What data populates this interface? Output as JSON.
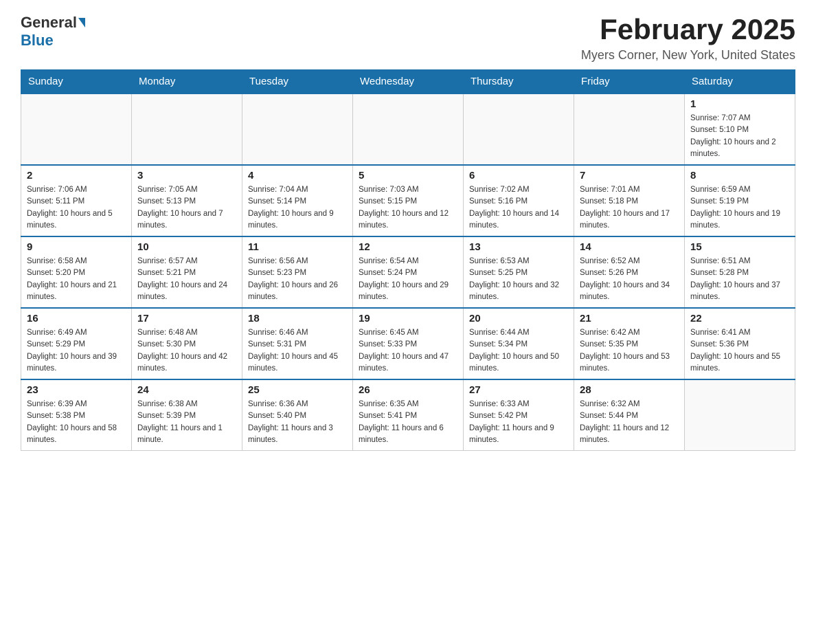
{
  "logo": {
    "general": "General",
    "blue": "Blue"
  },
  "header": {
    "month_title": "February 2025",
    "location": "Myers Corner, New York, United States"
  },
  "days_of_week": [
    "Sunday",
    "Monday",
    "Tuesday",
    "Wednesday",
    "Thursday",
    "Friday",
    "Saturday"
  ],
  "weeks": [
    [
      {
        "day": "",
        "sunrise": "",
        "sunset": "",
        "daylight": ""
      },
      {
        "day": "",
        "sunrise": "",
        "sunset": "",
        "daylight": ""
      },
      {
        "day": "",
        "sunrise": "",
        "sunset": "",
        "daylight": ""
      },
      {
        "day": "",
        "sunrise": "",
        "sunset": "",
        "daylight": ""
      },
      {
        "day": "",
        "sunrise": "",
        "sunset": "",
        "daylight": ""
      },
      {
        "day": "",
        "sunrise": "",
        "sunset": "",
        "daylight": ""
      },
      {
        "day": "1",
        "sunrise": "Sunrise: 7:07 AM",
        "sunset": "Sunset: 5:10 PM",
        "daylight": "Daylight: 10 hours and 2 minutes."
      }
    ],
    [
      {
        "day": "2",
        "sunrise": "Sunrise: 7:06 AM",
        "sunset": "Sunset: 5:11 PM",
        "daylight": "Daylight: 10 hours and 5 minutes."
      },
      {
        "day": "3",
        "sunrise": "Sunrise: 7:05 AM",
        "sunset": "Sunset: 5:13 PM",
        "daylight": "Daylight: 10 hours and 7 minutes."
      },
      {
        "day": "4",
        "sunrise": "Sunrise: 7:04 AM",
        "sunset": "Sunset: 5:14 PM",
        "daylight": "Daylight: 10 hours and 9 minutes."
      },
      {
        "day": "5",
        "sunrise": "Sunrise: 7:03 AM",
        "sunset": "Sunset: 5:15 PM",
        "daylight": "Daylight: 10 hours and 12 minutes."
      },
      {
        "day": "6",
        "sunrise": "Sunrise: 7:02 AM",
        "sunset": "Sunset: 5:16 PM",
        "daylight": "Daylight: 10 hours and 14 minutes."
      },
      {
        "day": "7",
        "sunrise": "Sunrise: 7:01 AM",
        "sunset": "Sunset: 5:18 PM",
        "daylight": "Daylight: 10 hours and 17 minutes."
      },
      {
        "day": "8",
        "sunrise": "Sunrise: 6:59 AM",
        "sunset": "Sunset: 5:19 PM",
        "daylight": "Daylight: 10 hours and 19 minutes."
      }
    ],
    [
      {
        "day": "9",
        "sunrise": "Sunrise: 6:58 AM",
        "sunset": "Sunset: 5:20 PM",
        "daylight": "Daylight: 10 hours and 21 minutes."
      },
      {
        "day": "10",
        "sunrise": "Sunrise: 6:57 AM",
        "sunset": "Sunset: 5:21 PM",
        "daylight": "Daylight: 10 hours and 24 minutes."
      },
      {
        "day": "11",
        "sunrise": "Sunrise: 6:56 AM",
        "sunset": "Sunset: 5:23 PM",
        "daylight": "Daylight: 10 hours and 26 minutes."
      },
      {
        "day": "12",
        "sunrise": "Sunrise: 6:54 AM",
        "sunset": "Sunset: 5:24 PM",
        "daylight": "Daylight: 10 hours and 29 minutes."
      },
      {
        "day": "13",
        "sunrise": "Sunrise: 6:53 AM",
        "sunset": "Sunset: 5:25 PM",
        "daylight": "Daylight: 10 hours and 32 minutes."
      },
      {
        "day": "14",
        "sunrise": "Sunrise: 6:52 AM",
        "sunset": "Sunset: 5:26 PM",
        "daylight": "Daylight: 10 hours and 34 minutes."
      },
      {
        "day": "15",
        "sunrise": "Sunrise: 6:51 AM",
        "sunset": "Sunset: 5:28 PM",
        "daylight": "Daylight: 10 hours and 37 minutes."
      }
    ],
    [
      {
        "day": "16",
        "sunrise": "Sunrise: 6:49 AM",
        "sunset": "Sunset: 5:29 PM",
        "daylight": "Daylight: 10 hours and 39 minutes."
      },
      {
        "day": "17",
        "sunrise": "Sunrise: 6:48 AM",
        "sunset": "Sunset: 5:30 PM",
        "daylight": "Daylight: 10 hours and 42 minutes."
      },
      {
        "day": "18",
        "sunrise": "Sunrise: 6:46 AM",
        "sunset": "Sunset: 5:31 PM",
        "daylight": "Daylight: 10 hours and 45 minutes."
      },
      {
        "day": "19",
        "sunrise": "Sunrise: 6:45 AM",
        "sunset": "Sunset: 5:33 PM",
        "daylight": "Daylight: 10 hours and 47 minutes."
      },
      {
        "day": "20",
        "sunrise": "Sunrise: 6:44 AM",
        "sunset": "Sunset: 5:34 PM",
        "daylight": "Daylight: 10 hours and 50 minutes."
      },
      {
        "day": "21",
        "sunrise": "Sunrise: 6:42 AM",
        "sunset": "Sunset: 5:35 PM",
        "daylight": "Daylight: 10 hours and 53 minutes."
      },
      {
        "day": "22",
        "sunrise": "Sunrise: 6:41 AM",
        "sunset": "Sunset: 5:36 PM",
        "daylight": "Daylight: 10 hours and 55 minutes."
      }
    ],
    [
      {
        "day": "23",
        "sunrise": "Sunrise: 6:39 AM",
        "sunset": "Sunset: 5:38 PM",
        "daylight": "Daylight: 10 hours and 58 minutes."
      },
      {
        "day": "24",
        "sunrise": "Sunrise: 6:38 AM",
        "sunset": "Sunset: 5:39 PM",
        "daylight": "Daylight: 11 hours and 1 minute."
      },
      {
        "day": "25",
        "sunrise": "Sunrise: 6:36 AM",
        "sunset": "Sunset: 5:40 PM",
        "daylight": "Daylight: 11 hours and 3 minutes."
      },
      {
        "day": "26",
        "sunrise": "Sunrise: 6:35 AM",
        "sunset": "Sunset: 5:41 PM",
        "daylight": "Daylight: 11 hours and 6 minutes."
      },
      {
        "day": "27",
        "sunrise": "Sunrise: 6:33 AM",
        "sunset": "Sunset: 5:42 PM",
        "daylight": "Daylight: 11 hours and 9 minutes."
      },
      {
        "day": "28",
        "sunrise": "Sunrise: 6:32 AM",
        "sunset": "Sunset: 5:44 PM",
        "daylight": "Daylight: 11 hours and 12 minutes."
      },
      {
        "day": "",
        "sunrise": "",
        "sunset": "",
        "daylight": ""
      }
    ]
  ]
}
